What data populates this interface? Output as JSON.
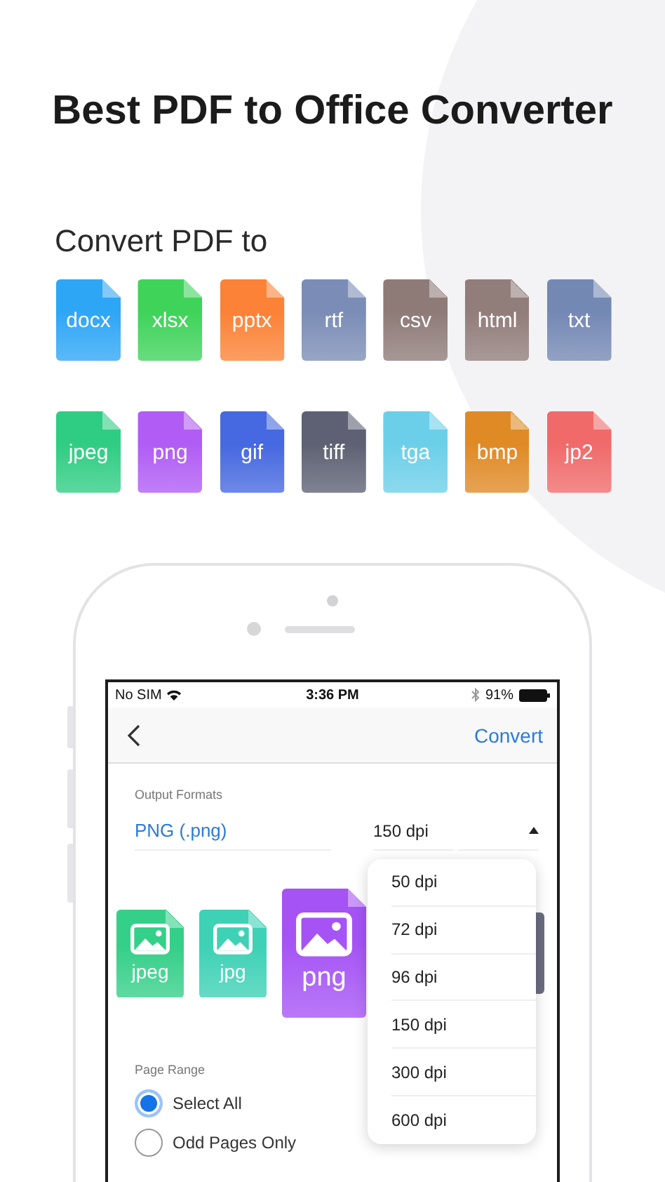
{
  "title": "Best PDF to Office Converter",
  "subtitle": "Convert PDF to",
  "formats": [
    {
      "label": "docx",
      "color": "#2ea6f6"
    },
    {
      "label": "xlsx",
      "color": "#3fd35a"
    },
    {
      "label": "pptx",
      "color": "#fb8236"
    },
    {
      "label": "rtf",
      "color": "#7b8db6"
    },
    {
      "label": "csv",
      "color": "#8e7b78"
    },
    {
      "label": "html",
      "color": "#917d7a"
    },
    {
      "label": "txt",
      "color": "#7488b4"
    },
    {
      "label": "jpeg",
      "color": "#2fcd83"
    },
    {
      "label": "png",
      "color": "#b05cf5"
    },
    {
      "label": "gif",
      "color": "#4668e0"
    },
    {
      "label": "tiff",
      "color": "#5d6173"
    },
    {
      "label": "tga",
      "color": "#6ccfe9"
    },
    {
      "label": "bmp",
      "color": "#e08a25"
    },
    {
      "label": "jp2",
      "color": "#f06a6a"
    }
  ],
  "phone": {
    "status_bar": {
      "carrier": "No SIM",
      "time": "3:36 PM",
      "battery": "91%"
    },
    "nav": {
      "action": "Convert"
    },
    "output": {
      "label": "Output Formats",
      "format": "PNG (.png)",
      "resolution": "150 dpi",
      "expanded": true
    },
    "carousel": [
      {
        "label": "jpeg",
        "color": "#34cf88",
        "selected": false
      },
      {
        "label": "jpg",
        "color": "#3dd1b5",
        "selected": false
      },
      {
        "label": "png",
        "color": "#a553f5",
        "selected": true
      }
    ],
    "dpi_menu": [
      "50 dpi",
      "72 dpi",
      "96 dpi",
      "150 dpi",
      "300 dpi",
      "600 dpi"
    ],
    "page_range": {
      "label": "Page Range",
      "options": [
        {
          "label": "Select All",
          "selected": true
        },
        {
          "label": "Odd Pages Only",
          "selected": false
        }
      ]
    }
  }
}
